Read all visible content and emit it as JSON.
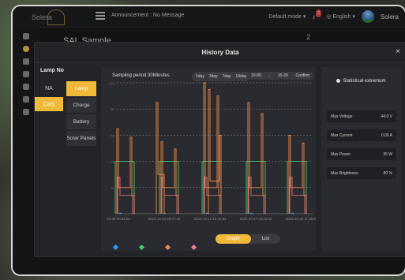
{
  "app": {
    "logo": "Solera",
    "announcement": "Announcement : No Message",
    "mode": "Default mode",
    "notification_count": "2",
    "language": "English",
    "user": "Solera"
  },
  "background_page": {
    "project_title": "SAL Sample",
    "count": "2"
  },
  "modal": {
    "title": "History Data",
    "close": "×",
    "lamp_no_label": "Lamp No",
    "left_items": [
      "NA",
      "Cary"
    ],
    "type_items": [
      "Lamp",
      "Charge",
      "Battery",
      "Solar Panels"
    ],
    "period": "Sampling period:30Minutes",
    "day_buttons": [
      "1day",
      "3day",
      "7day",
      "14day"
    ],
    "date_from": "10-09",
    "date_sep": ",",
    "date_to": "10-20",
    "confirm": "Confirm",
    "view_buttons": [
      "Graph",
      "List"
    ],
    "stat_title": "Statistical extremum",
    "stats": [
      {
        "label": "Max Voltage",
        "value": "44.0 V"
      },
      {
        "label": "Max Current",
        "value": "0.00 A"
      },
      {
        "label": "Max Power",
        "value": "35 W"
      },
      {
        "label": "Max Brightness",
        "value": "80 %"
      }
    ]
  },
  "colors": {
    "accent": "#f0b93a",
    "series": [
      "#2ea3f2",
      "#3ccf6e",
      "#f08a4b",
      "#f07a8a"
    ]
  },
  "chart_data": {
    "type": "line",
    "y_ticks": [
      "100",
      "80",
      "60",
      "40",
      "20"
    ],
    "x_ticks": [
      "10-09 10:52:09",
      "2023-10-10 20:47:16",
      "2023-10-13 10:40:34",
      "2023-10-17 22:22:52",
      "2023-10-20 11:59:55"
    ],
    "ylim": [
      0,
      100
    ],
    "grid": true
  }
}
